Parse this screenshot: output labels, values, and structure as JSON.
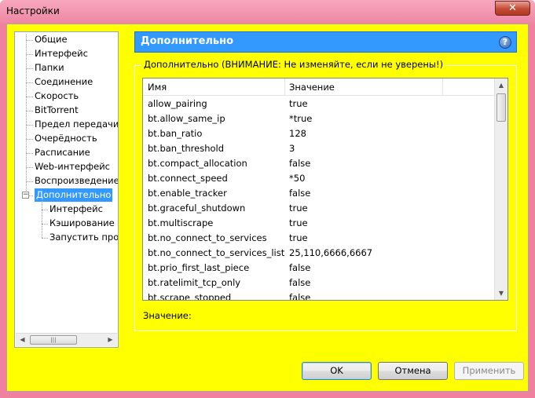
{
  "window": {
    "title": "Настройки",
    "close_label": "✕"
  },
  "tree": {
    "items": [
      {
        "label": "Общие",
        "level": 0
      },
      {
        "label": "Интерфейс",
        "level": 0
      },
      {
        "label": "Папки",
        "level": 0
      },
      {
        "label": "Соединение",
        "level": 0
      },
      {
        "label": "Скорость",
        "level": 0
      },
      {
        "label": "BitTorrent",
        "level": 0
      },
      {
        "label": "Предел передачи",
        "level": 0
      },
      {
        "label": "Очерёдность",
        "level": 0
      },
      {
        "label": "Расписание",
        "level": 0
      },
      {
        "label": "Web-интерфейс",
        "level": 0
      },
      {
        "label": "Воспроизведение",
        "level": 0
      },
      {
        "label": "Дополнительно",
        "level": 0,
        "selected": true,
        "expanded": true
      },
      {
        "label": "Интерфейс",
        "level": 1
      },
      {
        "label": "Кэширование",
        "level": 1
      },
      {
        "label": "Запустить прогр",
        "level": 1
      }
    ],
    "scroll_thumb_glyph": "|||"
  },
  "panel": {
    "title": "Дополнительно",
    "help_icon": "?",
    "group_label": "Дополнительно (ВНИМАНИЕ: Не изменяйте, если не уверены!)",
    "columns": {
      "name": "Имя",
      "value": "Значение"
    },
    "rows": [
      {
        "name": "allow_pairing",
        "value": "true"
      },
      {
        "name": "bt.allow_same_ip",
        "value": "*true"
      },
      {
        "name": "bt.ban_ratio",
        "value": "128"
      },
      {
        "name": "bt.ban_threshold",
        "value": "3"
      },
      {
        "name": "bt.compact_allocation",
        "value": "false"
      },
      {
        "name": "bt.connect_speed",
        "value": "*50"
      },
      {
        "name": "bt.enable_tracker",
        "value": "false"
      },
      {
        "name": "bt.graceful_shutdown",
        "value": "true"
      },
      {
        "name": "bt.multiscrape",
        "value": "true"
      },
      {
        "name": "bt.no_connect_to_services",
        "value": "true"
      },
      {
        "name": "bt.no_connect_to_services_list",
        "value": "25,110,6666,6667"
      },
      {
        "name": "bt.prio_first_last_piece",
        "value": "false"
      },
      {
        "name": "bt.ratelimit_tcp_only",
        "value": "false"
      },
      {
        "name": "bt.scrape_stopped",
        "value": "false"
      }
    ],
    "value_label": "Значение:"
  },
  "buttons": {
    "ok": "OK",
    "cancel": "Отмена",
    "apply": "Применить"
  },
  "colors": {
    "window_frame": "#f080a0",
    "client_bg": "#ffff00",
    "accent": "#3399ff"
  }
}
